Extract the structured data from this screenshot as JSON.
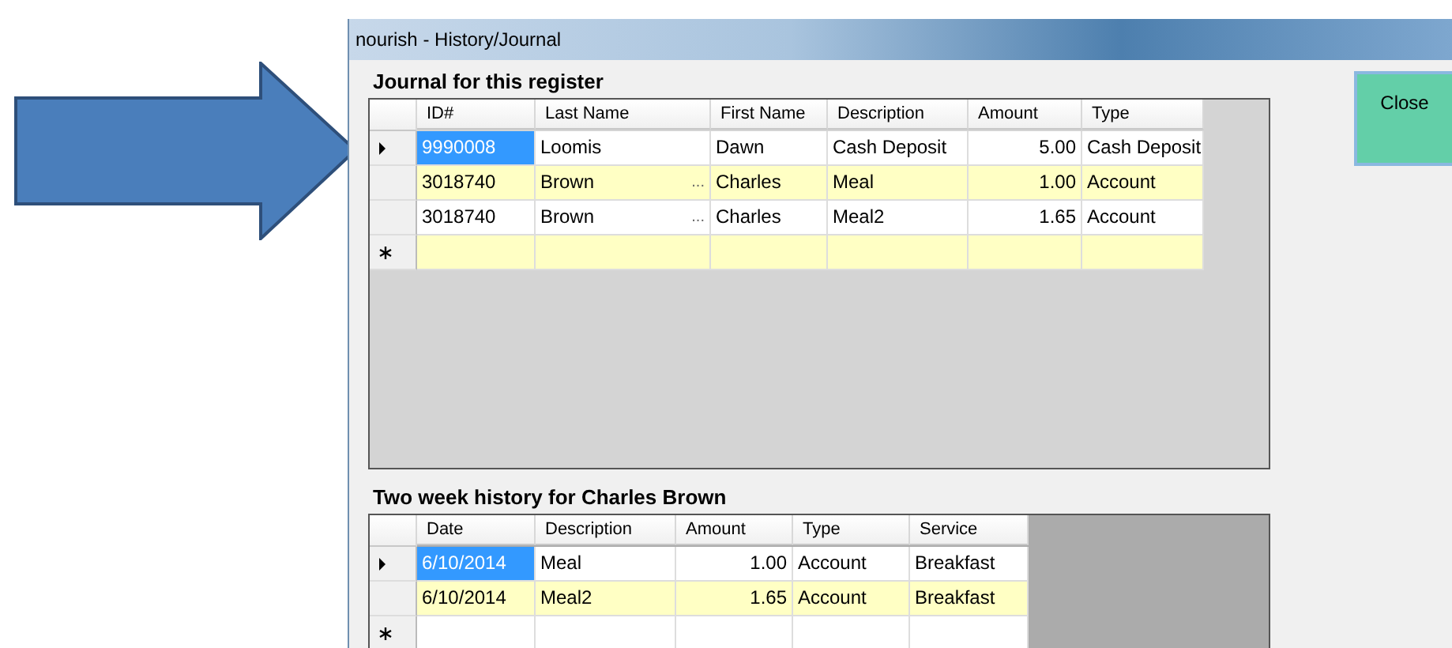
{
  "window": {
    "title": "nourish - History/Journal"
  },
  "close_button": {
    "label": "Close"
  },
  "journal": {
    "title": "Journal for this register",
    "new_row": true,
    "columns": [
      {
        "label": "ID#",
        "kind": "text"
      },
      {
        "label": "Last Name",
        "kind": "text"
      },
      {
        "label": "First Name",
        "kind": "text"
      },
      {
        "label": "Description",
        "kind": "text"
      },
      {
        "label": "Amount",
        "kind": "number"
      },
      {
        "label": "Type",
        "kind": "text"
      }
    ],
    "rows": [
      {
        "selected": true,
        "cells": [
          "9990008",
          "Loomis",
          "Dawn",
          "Cash Deposit",
          "5.00",
          "Cash Deposit"
        ]
      },
      {
        "selected": false,
        "cells": [
          "3018740",
          {
            "text": "Brown",
            "button": "..."
          },
          "Charles",
          "Meal",
          "1.00",
          "Account"
        ]
      },
      {
        "selected": false,
        "cells": [
          "3018740",
          {
            "text": "Brown",
            "button": "..."
          },
          "Charles",
          "Meal2",
          "1.65",
          "Account"
        ]
      }
    ]
  },
  "history": {
    "title": "Two week history for Charles Brown",
    "new_row": true,
    "columns": [
      {
        "label": "Date",
        "kind": "text"
      },
      {
        "label": "Description",
        "kind": "text"
      },
      {
        "label": "Amount",
        "kind": "number"
      },
      {
        "label": "Type",
        "kind": "text"
      },
      {
        "label": "Service",
        "kind": "text"
      }
    ],
    "rows": [
      {
        "selected": true,
        "cells": [
          "6/10/2014",
          "Meal",
          "1.00",
          "Account",
          "Breakfast"
        ]
      },
      {
        "selected": false,
        "cells": [
          "6/10/2014",
          "Meal2",
          "1.65",
          "Account",
          "Breakfast"
        ]
      }
    ]
  }
}
